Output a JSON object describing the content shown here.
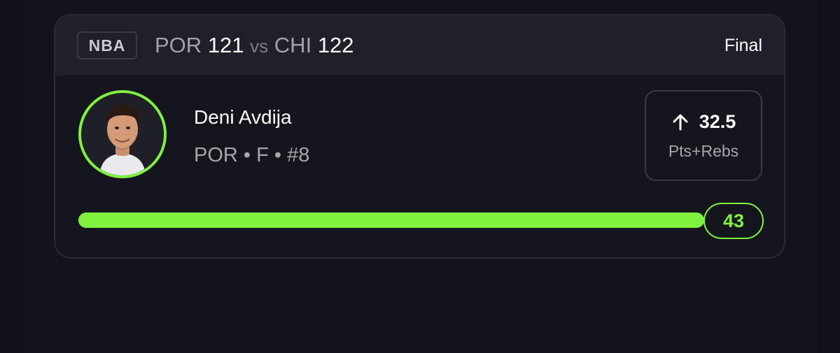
{
  "game": {
    "league": "NBA",
    "away_team": "POR",
    "away_score": "121",
    "vs_label": "vs",
    "home_team": "CHI",
    "home_score": "122",
    "status": "Final"
  },
  "player": {
    "name": "Deni Avdija",
    "team": "POR",
    "position": "F",
    "number": "#8",
    "separator": "•"
  },
  "prop": {
    "direction": "up",
    "direction_icon": "arrow-up-icon",
    "line": "32.5",
    "stat": "Pts+Rebs"
  },
  "progress": {
    "actual": "43",
    "fill_fraction": 1.0
  },
  "colors": {
    "accent": "#80f23d",
    "card_bg": "#15151d",
    "header_bg": "#20202a",
    "text_primary": "#ffffff",
    "text_secondary": "#a6a6ad"
  }
}
